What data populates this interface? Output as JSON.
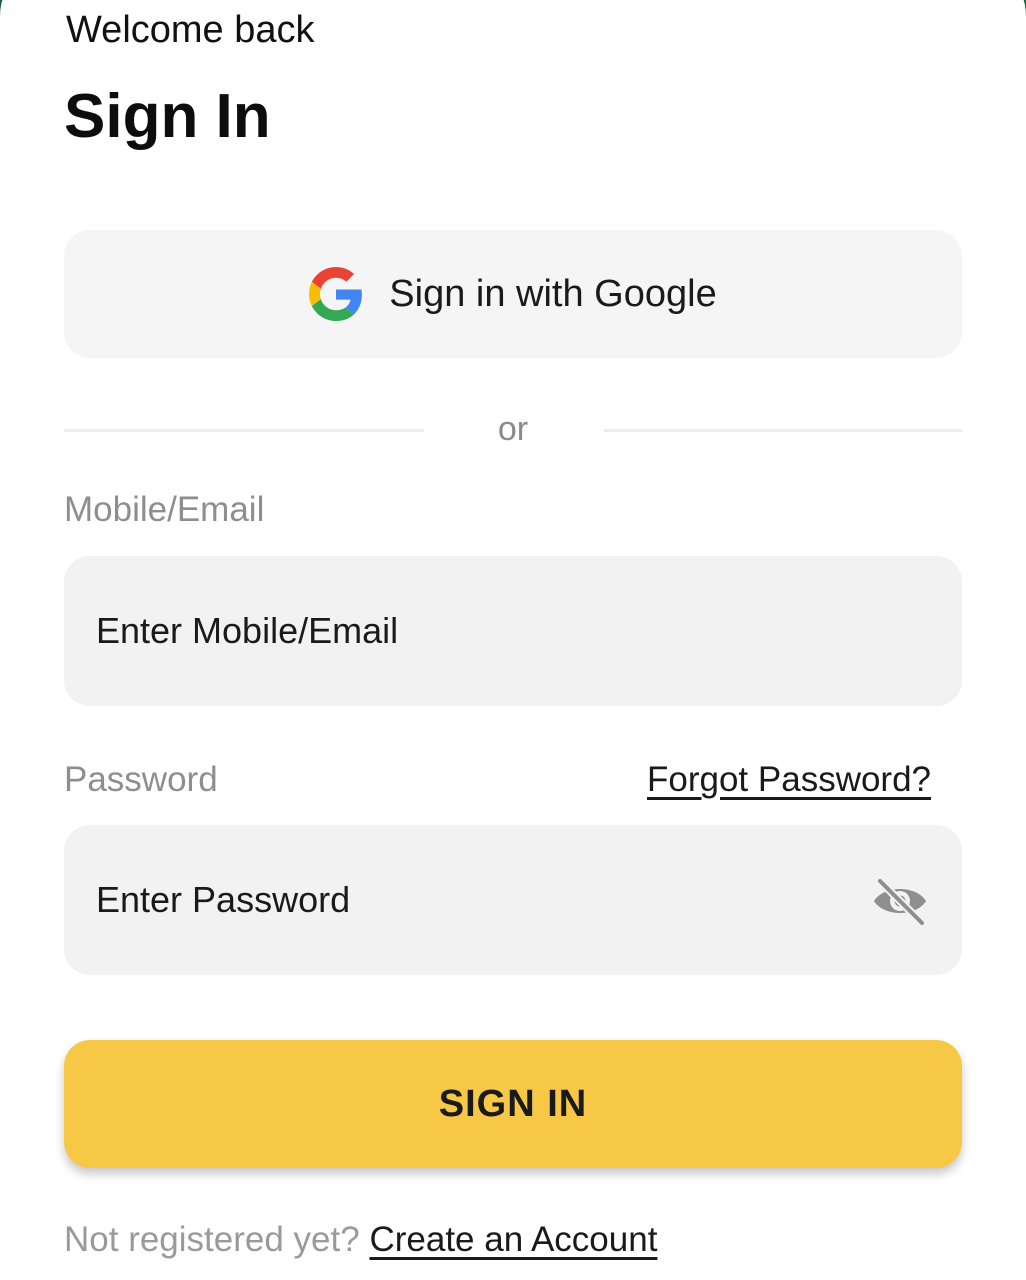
{
  "header": {
    "welcome": "Welcome back",
    "title": "Sign In"
  },
  "google": {
    "label": "Sign in with Google",
    "icon": "google-g-icon"
  },
  "divider": {
    "text": "or"
  },
  "email": {
    "label": "Mobile/Email",
    "placeholder": "Enter Mobile/Email",
    "value": ""
  },
  "password": {
    "label": "Password",
    "forgot_link": "Forgot Password?",
    "placeholder": "Enter Password",
    "value": "",
    "toggle_icon": "eye-off-icon"
  },
  "signin": {
    "label": "SIGN IN"
  },
  "footer": {
    "prompt": "Not registered yet?",
    "link": "Create an Account"
  },
  "colors": {
    "primary_button": "#f7c846",
    "background_accent": "#1f5a3c",
    "input_background": "#f2f2f2",
    "google_button_background": "#f5f5f5",
    "muted_text": "#8e8e8e"
  }
}
